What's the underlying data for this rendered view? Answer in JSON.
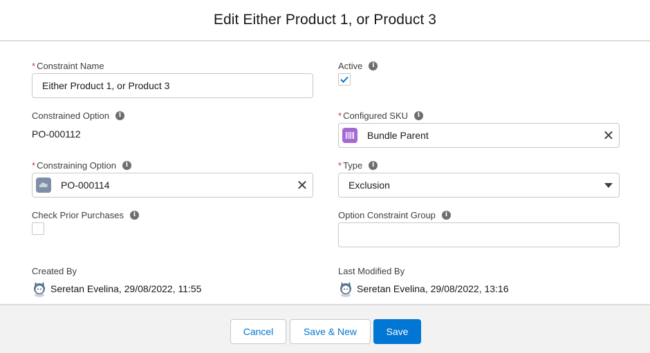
{
  "modal": {
    "title": "Edit Either Product 1, or Product 3"
  },
  "fields": {
    "constraint_name": {
      "label": "Constraint Name",
      "required": "*",
      "value": "Either Product 1, or Product 3"
    },
    "active": {
      "label": "Active",
      "checked": true
    },
    "constrained_option": {
      "label": "Constrained Option",
      "value": "PO-000112"
    },
    "configured_sku": {
      "label": "Configured SKU",
      "required": "*",
      "value": "Bundle Parent",
      "icon": "barcode-icon"
    },
    "constraining_option": {
      "label": "Constraining Option",
      "required": "*",
      "value": "PO-000114",
      "icon": "product-option-icon"
    },
    "type": {
      "label": "Type",
      "required": "*",
      "value": "Exclusion"
    },
    "check_prior_purchases": {
      "label": "Check Prior Purchases",
      "checked": false
    },
    "option_constraint_group": {
      "label": "Option Constraint Group",
      "value": ""
    },
    "created_by": {
      "label": "Created By",
      "value": "Seretan Evelina, 29/08/2022, 11:55"
    },
    "last_modified_by": {
      "label": "Last Modified By",
      "value": "Seretan Evelina, 29/08/2022, 13:16"
    }
  },
  "footer": {
    "cancel": "Cancel",
    "save_new": "Save & New",
    "save": "Save"
  },
  "colors": {
    "brand": "#0176d3",
    "required": "#c23934",
    "sku_icon": "#a569d4",
    "option_icon": "#7f8ea7"
  }
}
